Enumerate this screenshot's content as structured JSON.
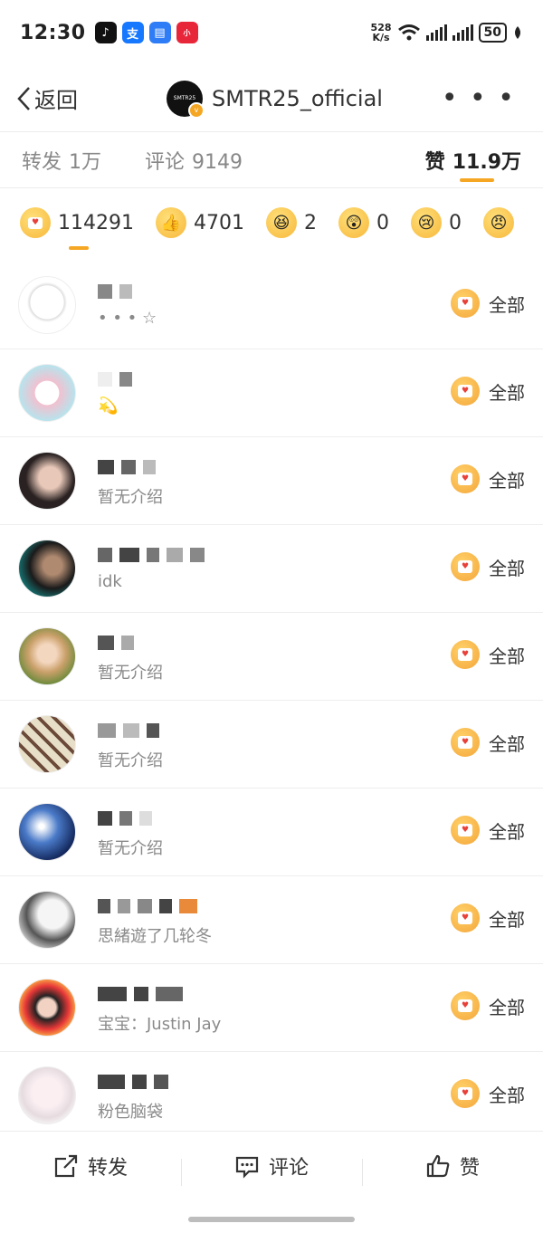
{
  "status_bar": {
    "time": "12:30",
    "net_speed_value": "528",
    "net_speed_unit": "K/s",
    "battery": "50",
    "app_icons": [
      "tiktok-icon",
      "alipay-icon",
      "message-icon",
      "xiaohongshu-icon"
    ]
  },
  "nav": {
    "back_label": "返回",
    "account_avatar_text": "SMTR25",
    "account_name": "SMTR25_official",
    "more_label": "• • •"
  },
  "tabs": [
    {
      "label": "转发",
      "count": "1万"
    },
    {
      "label": "评论",
      "count": "9149"
    },
    {
      "label": "赞",
      "count": "11.9万"
    }
  ],
  "reactions": [
    {
      "icon": "heart-face-icon",
      "count": "114291"
    },
    {
      "icon": "thumbs-up-icon",
      "count": "4701"
    },
    {
      "icon": "laugh-icon",
      "count": "2"
    },
    {
      "icon": "surprised-icon",
      "count": "0"
    },
    {
      "icon": "sad-icon",
      "count": "0"
    }
  ],
  "likers": [
    {
      "desc": "• • • ☆",
      "action": "全部"
    },
    {
      "desc": "💫",
      "action": "全部"
    },
    {
      "desc": "暂无介绍",
      "action": "全部"
    },
    {
      "desc": "idk",
      "action": "全部"
    },
    {
      "desc": "暂无介绍",
      "action": "全部"
    },
    {
      "desc": "暂无介绍",
      "action": "全部"
    },
    {
      "desc": "暂无介绍",
      "action": "全部"
    },
    {
      "desc": "思緒遊了几轮冬",
      "action": "全部"
    },
    {
      "desc": "宝宝：Justin Jay",
      "action": "全部"
    },
    {
      "desc": "粉色脑袋",
      "action": "全部"
    }
  ],
  "bottom_bar": {
    "repost_label": "转发",
    "comment_label": "评论",
    "like_label": "赞"
  },
  "colors": {
    "accent": "#f5a623",
    "text": "#222222",
    "muted": "#8a8a8a"
  }
}
